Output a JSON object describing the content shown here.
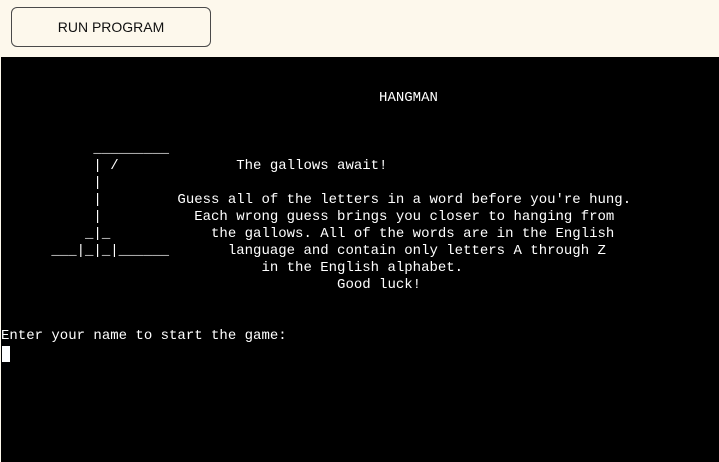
{
  "toolbar": {
    "run_label": "RUN PROGRAM"
  },
  "terminal": {
    "lines": [
      "",
      "",
      "                                             HANGMAN",
      "",
      "",
      "           _________",
      "           | /              The gallows await!",
      "           |",
      "           |         Guess all of the letters in a word before you're hung.",
      "           |           Each wrong guess brings you closer to hanging from",
      "          _|_            the gallows. All of the words are in the English",
      "      ___|_|_|______       language and contain only letters A through Z",
      "                               in the English alphabet.",
      "                                        Good luck!",
      "",
      "",
      "Enter your name to start the game:"
    ]
  }
}
